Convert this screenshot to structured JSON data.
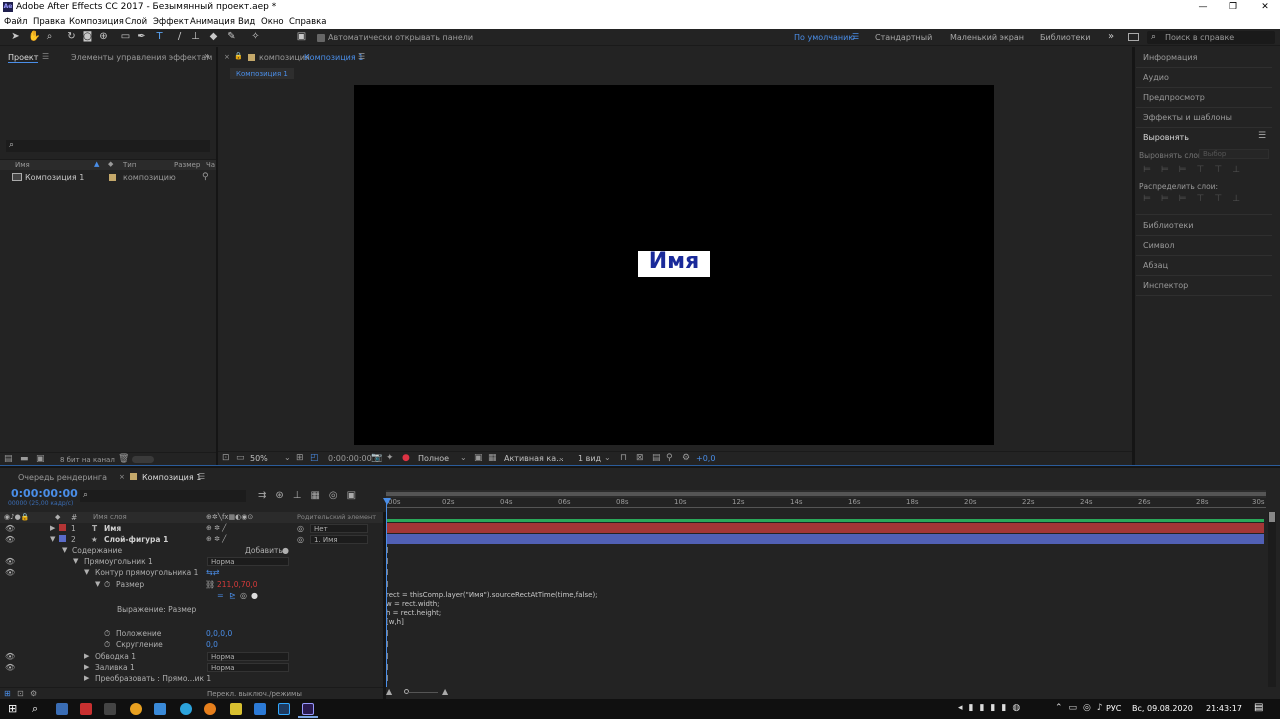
{
  "window": {
    "title": "Adobe After Effects CC 2017 - Безымянный проект.aep *",
    "app_icon": "Ae"
  },
  "menu": [
    "Файл",
    "Правка",
    "Композиция",
    "Слой",
    "Эффект",
    "Анимация",
    "Вид",
    "Окно",
    "Справка"
  ],
  "toolbar": {
    "auto_open_label": "Автоматически открывать панели",
    "workspaces": [
      "По умолчанию",
      "Стандартный",
      "Маленький экран",
      "Библиотеки"
    ],
    "search_placeholder": "Поиск в справке"
  },
  "project": {
    "tab_project": "Проект",
    "tab_effects": "Элементы управления эффектам",
    "search_glyph": "⌕",
    "columns": {
      "name": "Имя",
      "type": "Тип",
      "size": "Размер",
      "extra": "Ча"
    },
    "items": [
      {
        "name": "Композиция 1",
        "type": "композицию"
      }
    ],
    "bpc_label": "8 бит на канал"
  },
  "comp_viewer": {
    "tab_prefix": "композиция",
    "tab_name": "Композиция 1",
    "breadcrumb": "Композиция 1",
    "text": "Имя",
    "zoom": "50%",
    "timecode": "0:00:00:00",
    "resolution": "Полное",
    "camera": "Активная ка...",
    "views": "1 вид",
    "exposure": "+0,0"
  },
  "right_panels": {
    "items": [
      "Информация",
      "Аудио",
      "Предпросмотр",
      "Эффекты и шаблоны"
    ],
    "align_title": "Выровнять",
    "align_layers_label": "Выровнять слои",
    "align_to": "Выбор",
    "distribute_label": "Распределить слои:",
    "bottom_items": [
      "Библиотеки",
      "Символ",
      "Абзац",
      "Инспектор"
    ]
  },
  "timeline": {
    "tab_render": "Очередь рендеринга",
    "tab_comp": "Композиция 1",
    "timecode": "0:00:00:00",
    "fps_info": "00000 (25,00 кадр/с)",
    "col_hash": "#",
    "col_layer_name": "Имя слоя",
    "col_parent": "Родительский элемент",
    "ruler": [
      "00s",
      "02s",
      "04s",
      "06s",
      "08s",
      "10s",
      "12s",
      "14s",
      "16s",
      "18s",
      "20s",
      "22s",
      "24s",
      "26s",
      "28s",
      "30s"
    ],
    "layers": [
      {
        "num": "1",
        "type_glyph": "T",
        "name": "Имя",
        "parent": "Нет",
        "color": "#b33535"
      },
      {
        "num": "2",
        "type_glyph": "★",
        "name": "Слой-фигура 1",
        "parent": "1. Имя",
        "color": "#5a6bc8"
      }
    ],
    "props": {
      "contents": "Содержание",
      "add": "Добавить:",
      "rect": "Прямоугольник 1",
      "rect_mode": "Норма",
      "rect_path": "Контур прямоугольника 1",
      "size": "Размер",
      "size_value": "211,0,70,0",
      "expression_label": "Выражение: Размер",
      "position": "Положение",
      "position_value": "0,0,0,0",
      "roundness": "Скругление",
      "roundness_value": "0,0",
      "stroke": "Обводка 1",
      "stroke_mode": "Норма",
      "fill": "Заливка 1",
      "fill_mode": "Норма",
      "transform": "Преобразовать : Прямо...ик 1"
    },
    "expression_lines": [
      "rect = thisComp.layer(\"Имя\").sourceRectAtTime(time,false);",
      "w = rect.width;",
      "h = rect.height;",
      "[w,h]"
    ],
    "footer": "Перекл. выключ./режимы"
  },
  "taskbar": {
    "lang": "РУС",
    "date": "Вс, 09.08.2020",
    "time": "21:43:17"
  },
  "colors": {
    "accent": "#4a8ee8",
    "layer1": "#b33535",
    "layer2": "#5a6bc8",
    "green": "#2aa85a"
  }
}
